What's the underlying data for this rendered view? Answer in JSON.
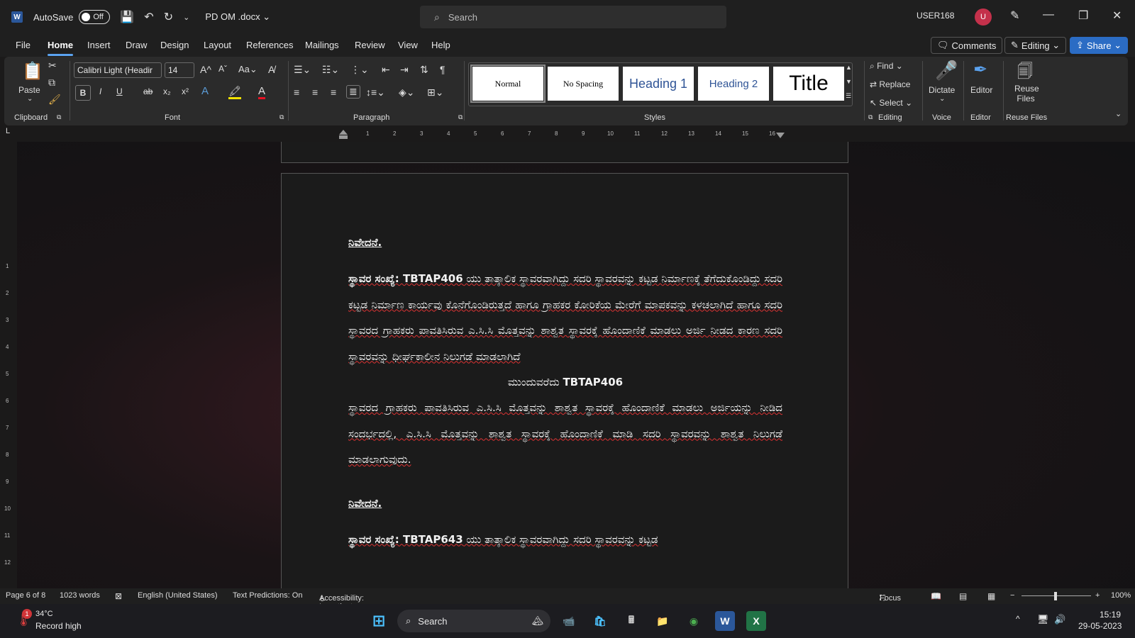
{
  "titlebar": {
    "app_icon": "W",
    "autosave_label": "AutoSave",
    "autosave_state": "Off",
    "document_name": "PD OM .docx",
    "search_placeholder": "Search",
    "user_name": "USER168",
    "avatar_initial": "U"
  },
  "menu": {
    "tabs": [
      "File",
      "Home",
      "Insert",
      "Draw",
      "Design",
      "Layout",
      "References",
      "Mailings",
      "Review",
      "View",
      "Help"
    ],
    "active_tab": "Home",
    "comments_label": "Comments",
    "editing_label": "Editing",
    "share_label": "Share"
  },
  "ribbon": {
    "clipboard": {
      "paste_label": "Paste",
      "group_label": "Clipboard"
    },
    "font": {
      "font_name": "Calibri Light (Headir",
      "font_size": "14",
      "group_label": "Font",
      "bold": "B",
      "italic": "I",
      "underline": "U",
      "strike": "ab",
      "subscript": "x₂",
      "superscript": "x²"
    },
    "paragraph": {
      "group_label": "Paragraph"
    },
    "styles": {
      "group_label": "Styles",
      "items": [
        "Normal",
        "No Spacing",
        "Heading 1",
        "Heading 2",
        "Title"
      ]
    },
    "editing": {
      "find": "Find",
      "replace": "Replace",
      "select": "Select",
      "group_label": "Editing"
    },
    "voice": {
      "dictate": "Dictate",
      "group_label": "Voice"
    },
    "editor": {
      "label": "Editor",
      "group_label": "Editor"
    },
    "reuse": {
      "label_line1": "Reuse",
      "label_line2": "Files",
      "group_label": "Reuse Files"
    }
  },
  "document": {
    "heading1": "ನಿವೇದನೆ.",
    "para1_bold": "ಸ್ಥಾವರ ಸಂಖ್ಯೆ: TBTAP406",
    "para1": " ಯು ತಾತ್ಕಾಲಿಕ ಸ್ಥಾವರವಾಗಿದ್ದು ಸದರಿ ಸ್ಥಾವರವನ್ನು ಕಟ್ಟಡ ನಿರ್ಮಾಣಕ್ಕೆ ತೆಗೆದುಕೊಂಡಿದ್ದು ಸದರಿ ಕಟ್ಟಡ ನಿರ್ಮಾಣ ಕಾರ್ಯವು ಕೊನೆಗೊಂಡಿರುತ್ತದೆ ಹಾಗೂ ಗ್ರಾಹಕರ ಕೋರಿಕೆಯ ಮೇರೆಗೆ ಮಾಪಕವನ್ನು ಕಳಚಲಾಗಿದೆ ಹಾಗೂ ಸದರಿ ಸ್ಥಾವರದ ಗ್ರಾಹಕರು ಪಾವತಿಸಿರುವ ಎ.ಸಿ.ಸಿ ಮೊತ್ತವನ್ನು ಶಾಶ್ವತ ಸ್ಥಾವರಕ್ಕೆ ಹೊಂದಾಣಿಕೆ ಮಾಡಲು ಅರ್ಜಿ ನೀಡದ ಕಾರಣ ಸದರಿ ಸ್ಥಾವರವನ್ನು ಧೀರ್ಘಕಾಲೀನ ನಿಲುಗಡೆ ಮಾಡಲಾಗಿದೆ",
    "center_prefix": "ಮುಂದುವರೆದು ",
    "center_code": "TBTAP406",
    "para2": " ಸ್ಥಾವರದ ಗ್ರಾಹಕರು ಪಾವತಿಸಿರುವ ಎ.ಸಿ.ಸಿ ಮೊತ್ತವನ್ನು ಶಾಶ್ವತ ಸ್ಥಾವರಕ್ಕೆ ಹೊಂದಾಣಿಕೆ ಮಾಡಲು ಅರ್ಜಿಯನ್ನು ನೀಡಿದ ಸಂದರ್ಭದಲ್ಲಿ, ಎ.ಸಿ.ಸಿ ಮೊತ್ತವನ್ನು ಶಾಶ್ವತ ಸ್ಥಾವರಕ್ಕೆ ಹೊಂದಾಣಿಕೆ ಮಾಡಿ ಸದರಿ ಸ್ಥಾವರವನ್ನು ಶಾಶ್ವತ ನಿಲುಗಡೆ ಮಾಡಲಾಗುವುದು.",
    "heading2": "ನಿವೇದನೆ.",
    "para3_bold": "ಸ್ಥಾವರ ಸಂಖ್ಯೆ: TBTAP643",
    "para3": " ಯು ತಾತ್ಕಾಲಿಕ ಸ್ಥಾವರವಾಗಿದ್ದು ಸದರಿ ಸ್ಥಾವರವನ್ನು ಕಟ್ಟಡ"
  },
  "statusbar": {
    "page": "Page 6 of 8",
    "words": "1023 words",
    "language": "English (United States)",
    "predictions": "Text Predictions: On",
    "accessibility": "Accessibility: Investigate",
    "focus": "Focus",
    "zoom": "100%"
  },
  "taskbar": {
    "temperature": "34°C",
    "weather_desc": "Record high",
    "weather_badge": "1",
    "search_label": "Search",
    "time": "15:19",
    "date": "29-05-2023"
  },
  "colors": {
    "word_blue": "#2b579a",
    "share_blue": "#2b6cc4",
    "accent": "#5ba3f0",
    "avatar": "#c4314b"
  }
}
